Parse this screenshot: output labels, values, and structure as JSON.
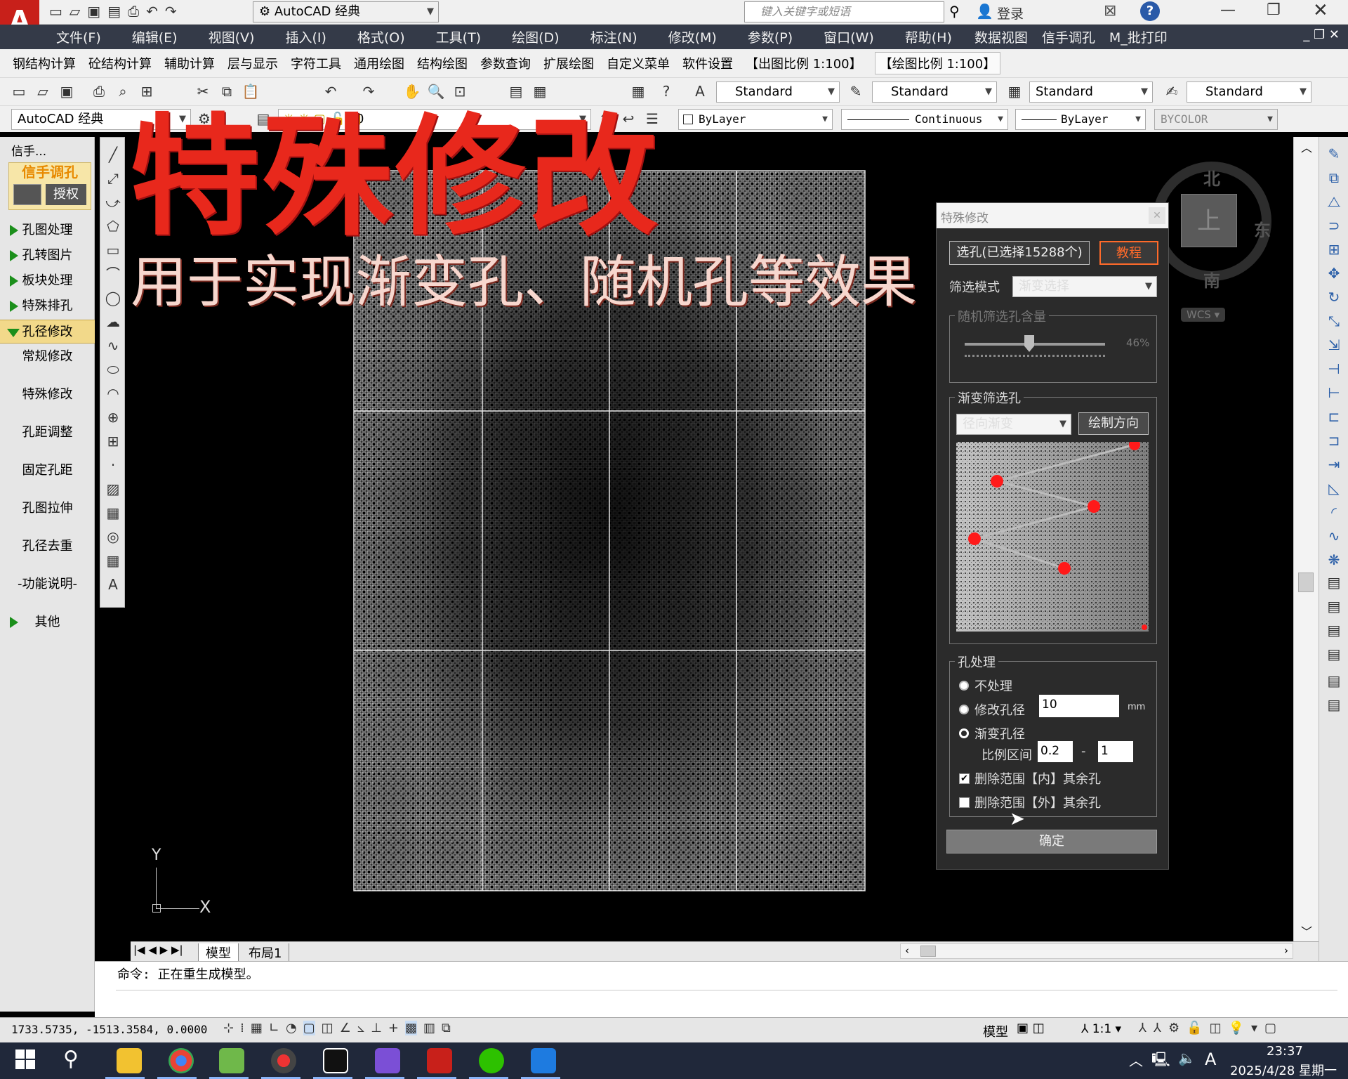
{
  "title_bar": {
    "workspace": "AutoCAD 经典",
    "search_placeholder": "键入关键字或短语",
    "login": "登录",
    "help": "?"
  },
  "menu": [
    "文件(F)",
    "编辑(E)",
    "视图(V)",
    "插入(I)",
    "格式(O)",
    "工具(T)",
    "绘图(D)",
    "标注(N)",
    "修改(M)",
    "参数(P)",
    "窗口(W)",
    "帮助(H)",
    "数据视图",
    "信手调孔",
    "M_批打印"
  ],
  "plugin_toolbar": [
    "钢结构计算",
    "砼结构计算",
    "辅助计算",
    "层与显示",
    "字符工具",
    "通用绘图",
    "结构绘图",
    "参数查询",
    "扩展绘图",
    "自定义菜单",
    "软件设置",
    "【出图比例 1:100】",
    "【绘图比例 1:100】"
  ],
  "styles": {
    "text_style": "Standard",
    "dim_style": "Standard",
    "table_style": "Standard",
    "mleader_style": "Standard"
  },
  "layers_bar": {
    "workspace": "AutoCAD 经典",
    "layer": "0",
    "color": "ByLayer",
    "linetype": "Continuous",
    "lineweight": "ByLayer",
    "plotstyle": "BYCOLOR"
  },
  "left_panel": {
    "header": "信手...",
    "brand": "信手调孔",
    "auth_button": "授权",
    "items": [
      {
        "label": "孔图处理",
        "expandable": true
      },
      {
        "label": "孔转图片",
        "expandable": true
      },
      {
        "label": "板块处理",
        "expandable": true
      },
      {
        "label": "特殊排孔",
        "expandable": true
      },
      {
        "label": "孔径修改",
        "expandable": true,
        "active": true
      },
      {
        "label": "常规修改",
        "expandable": false
      },
      {
        "label": "特殊修改",
        "expandable": false
      },
      {
        "label": "孔距调整",
        "expandable": false
      },
      {
        "label": "固定孔距",
        "expandable": false
      },
      {
        "label": "孔图拉伸",
        "expandable": false
      },
      {
        "label": "孔径去重",
        "expandable": false
      },
      {
        "label": "-功能说明-",
        "expandable": false
      },
      {
        "label": "其他",
        "expandable": true
      }
    ]
  },
  "overlay": {
    "title": "特殊修改",
    "subtitle": "用于实现渐变孔、随机孔等效果"
  },
  "viewcube": {
    "north": "北",
    "south": "南",
    "east": "东",
    "top": "上",
    "wcs": "WCS"
  },
  "ucs": {
    "x": "X",
    "y": "Y"
  },
  "dialog": {
    "title": "特殊修改",
    "select_button": "选孔(已选择15288个)",
    "tutorial_button": "教程",
    "filter_mode_label": "筛选模式",
    "filter_mode_value": "渐变选择",
    "random_group": "随机筛选孔含量",
    "random_percent": "46%",
    "random_level": 0.46,
    "gradient_group": "渐变筛选孔",
    "gradient_type": "径向渐变",
    "draw_direction_button": "绘制方向",
    "hole_group": "孔处理",
    "opt_none": "不处理",
    "opt_modify": "修改孔径",
    "diameter_value": "10",
    "diameter_unit": "mm",
    "opt_gradient": "渐变孔径",
    "ratio_label": "比例区间",
    "ratio_min": "0.2",
    "ratio_sep": "-",
    "ratio_max": "1",
    "delete_inside": "删除范围【内】其余孔",
    "delete_outside": "删除范围【外】其余孔",
    "delete_inside_checked": true,
    "delete_outside_checked": false,
    "confirm_button": "确定"
  },
  "tabs": [
    "模型",
    "布局1"
  ],
  "command_line": "命令: 正在重生成模型。",
  "status": {
    "coords": "1733.5735,  -1513.3584,  0.0000",
    "model": "模型",
    "scale": "1:1"
  },
  "taskbar": {
    "time": "23:37",
    "date": "2025/4/28 星期一",
    "ime": "A"
  },
  "colors": {
    "accent_red": "#e8281c",
    "menu_bg": "#343a48",
    "dialog_bg": "#2b2b2b",
    "tutorial_orange": "#ff6a2a"
  }
}
